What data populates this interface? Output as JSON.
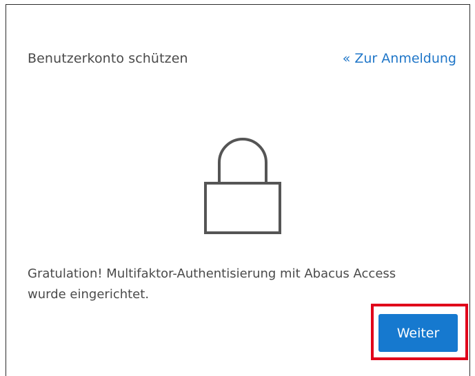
{
  "header": {
    "title": "Benutzerkonto schützen",
    "back_link": "« Zur Anmeldung"
  },
  "icon": {
    "name": "lock-icon"
  },
  "message": {
    "line1": "Gratulation! Multifaktor-Authentisierung mit Abacus Access",
    "line2": "wurde eingerichtet."
  },
  "actions": {
    "next_label": "Weiter"
  },
  "colors": {
    "accent": "#1679cf",
    "link": "#1f76c8",
    "highlight": "#e0001a",
    "text": "#4a4a4a"
  }
}
